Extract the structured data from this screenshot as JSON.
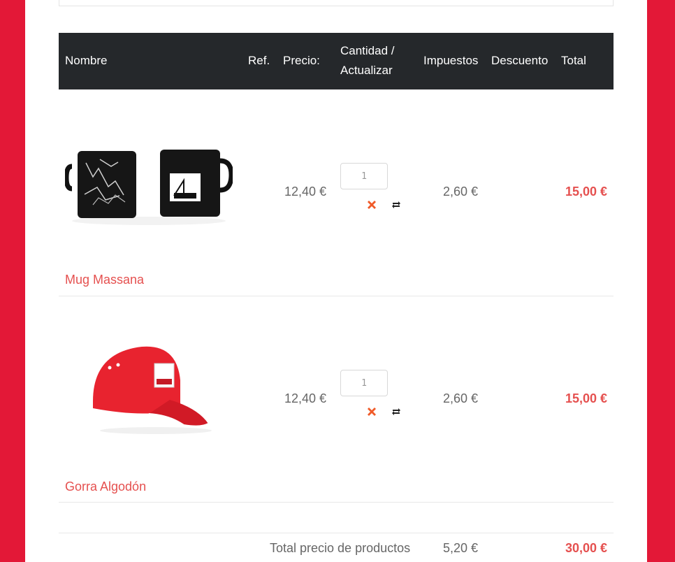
{
  "header": {
    "name": "Nombre",
    "ref": "Ref.",
    "price": "Precio:",
    "qty_line1": "Cantidad /",
    "qty_line2": "Actualizar",
    "tax": "Impuestos",
    "discount": "Descuento",
    "total": "Total"
  },
  "items": [
    {
      "name": "Mug Massana",
      "price": "12,40 €",
      "quantity": "1",
      "tax": "2,60 €",
      "total": "15,00 €",
      "image_icon": "mug-product-image"
    },
    {
      "name": "Gorra Algodón",
      "price": "12,40 €",
      "quantity": "1",
      "tax": "2,60 €",
      "total": "15,00 €",
      "image_icon": "cap-product-image"
    }
  ],
  "summary": {
    "label": "Total precio de productos",
    "tax": "5,20 €",
    "total": "30,00 €"
  },
  "colors": {
    "brand_red": "#e31837",
    "header_bg": "#25282b",
    "link": "#e5504f",
    "delete": "#f05a28"
  }
}
